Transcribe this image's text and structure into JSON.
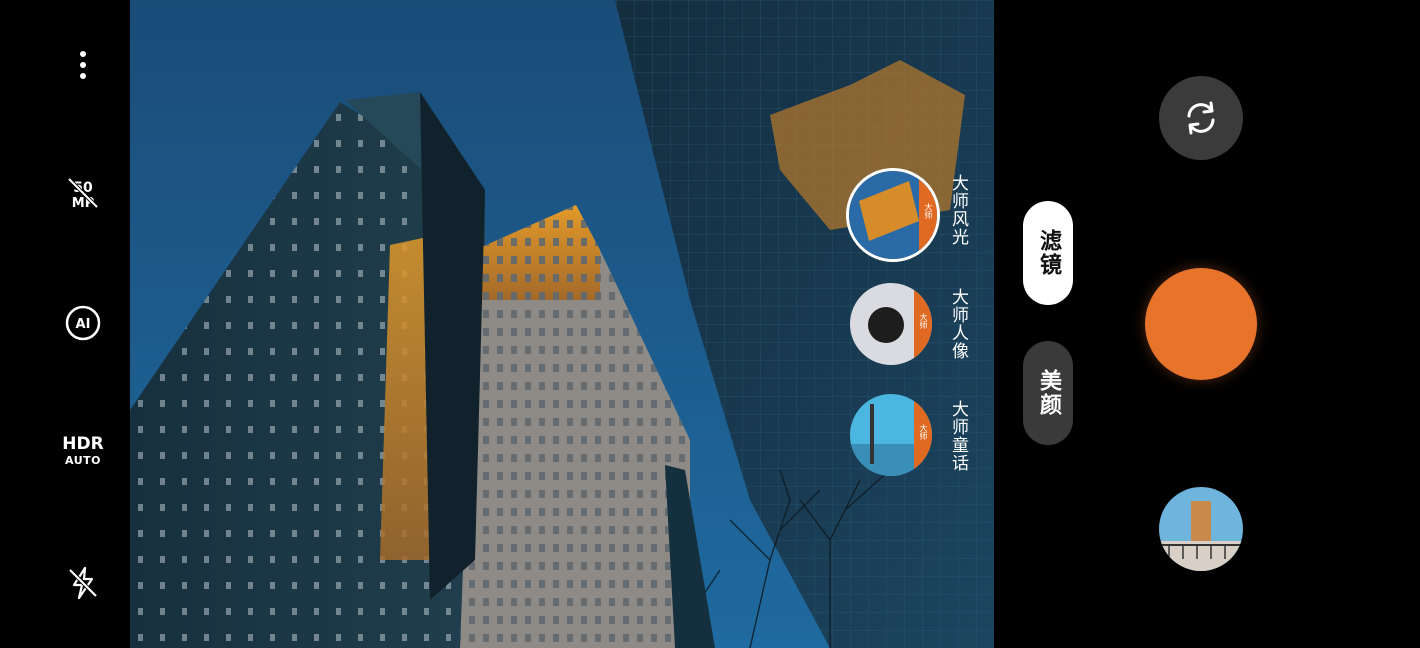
{
  "left_toolbar": {
    "more_icon": "more-vertical-icon",
    "resolution_icon": "megapixel-50-icon",
    "resolution_label": "50 MP",
    "ai_label": "AI",
    "hdr_label": "HDR",
    "hdr_mode": "AUTO",
    "flash_icon": "flash-off-icon"
  },
  "filters": [
    {
      "label": "大师风光",
      "badge": "大师",
      "selected": true
    },
    {
      "label": "大师人像",
      "badge": "大师",
      "selected": false
    },
    {
      "label": "大师童话",
      "badge": "大师",
      "selected": false
    }
  ],
  "mode_tabs": {
    "filter_label": "滤镜",
    "beauty_label": "美颜",
    "active": "滤镜"
  },
  "controls": {
    "switch_camera_icon": "switch-camera-icon",
    "shutter_color": "#e8732a",
    "gallery_icon": "gallery-thumbnail"
  }
}
